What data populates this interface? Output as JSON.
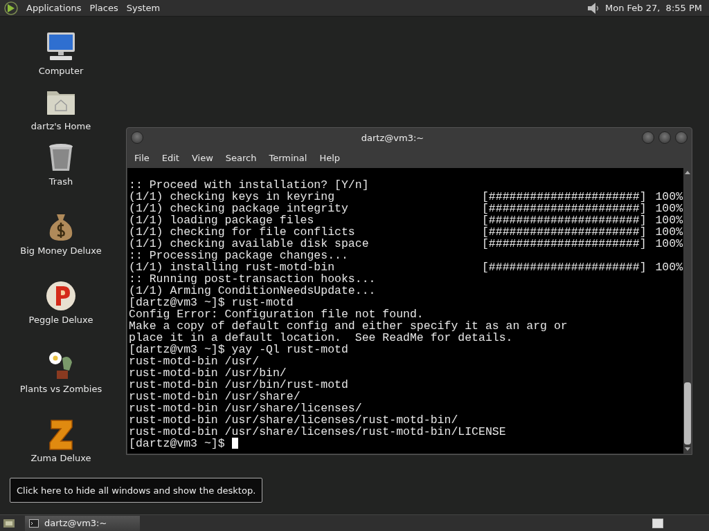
{
  "top_panel": {
    "menu": [
      "Applications",
      "Places",
      "System"
    ],
    "clock": "Mon Feb 27,  8:55 PM"
  },
  "desktop_icons": [
    {
      "label": "Computer",
      "kind": "computer"
    },
    {
      "label": "dartz's Home",
      "kind": "folder"
    },
    {
      "label": "Trash",
      "kind": "trash"
    },
    {
      "label": "Big Money Deluxe",
      "kind": "moneybag"
    },
    {
      "label": "Peggle Deluxe",
      "kind": "peggle"
    },
    {
      "label": "Plants vs Zombies",
      "kind": "plant"
    },
    {
      "label": "Zuma Deluxe",
      "kind": "zuma"
    }
  ],
  "terminal": {
    "title": "dartz@vm3:~",
    "menu": [
      "File",
      "Edit",
      "View",
      "Search",
      "Terminal",
      "Help"
    ],
    "lines": [
      {
        "text": ":: Proceed with installation? [Y/n]"
      },
      {
        "text": "(1/1) checking keys in keyring",
        "bar": "[######################]",
        "percent": "100%"
      },
      {
        "text": "(1/1) checking package integrity",
        "bar": "[######################]",
        "percent": "100%"
      },
      {
        "text": "(1/1) loading package files",
        "bar": "[######################]",
        "percent": "100%"
      },
      {
        "text": "(1/1) checking for file conflicts",
        "bar": "[######################]",
        "percent": "100%"
      },
      {
        "text": "(1/1) checking available disk space",
        "bar": "[######################]",
        "percent": "100%"
      },
      {
        "text": ":: Processing package changes..."
      },
      {
        "text": "(1/1) installing rust-motd-bin",
        "bar": "[######################]",
        "percent": "100%"
      },
      {
        "text": ":: Running post-transaction hooks..."
      },
      {
        "text": "(1/1) Arming ConditionNeedsUpdate..."
      },
      {
        "text": "[dartz@vm3 ~]$ rust-motd"
      },
      {
        "text": "Config Error: Configuration file not found."
      },
      {
        "text": "Make a copy of default config and either specify it as an arg or"
      },
      {
        "text": "place it in a default location.  See ReadMe for details."
      },
      {
        "text": "[dartz@vm3 ~]$ yay -Ql rust-motd"
      },
      {
        "text": "rust-motd-bin /usr/"
      },
      {
        "text": "rust-motd-bin /usr/bin/"
      },
      {
        "text": "rust-motd-bin /usr/bin/rust-motd"
      },
      {
        "text": "rust-motd-bin /usr/share/"
      },
      {
        "text": "rust-motd-bin /usr/share/licenses/"
      },
      {
        "text": "rust-motd-bin /usr/share/licenses/rust-motd-bin/"
      },
      {
        "text": "rust-motd-bin /usr/share/licenses/rust-motd-bin/LICENSE"
      },
      {
        "text": "[dartz@vm3 ~]$",
        "cursor": true
      }
    ]
  },
  "tooltip": "Click here to hide all windows and show the desktop.",
  "taskbar": {
    "tasks": [
      {
        "label": "dartz@vm3:~",
        "selected": true
      }
    ]
  }
}
